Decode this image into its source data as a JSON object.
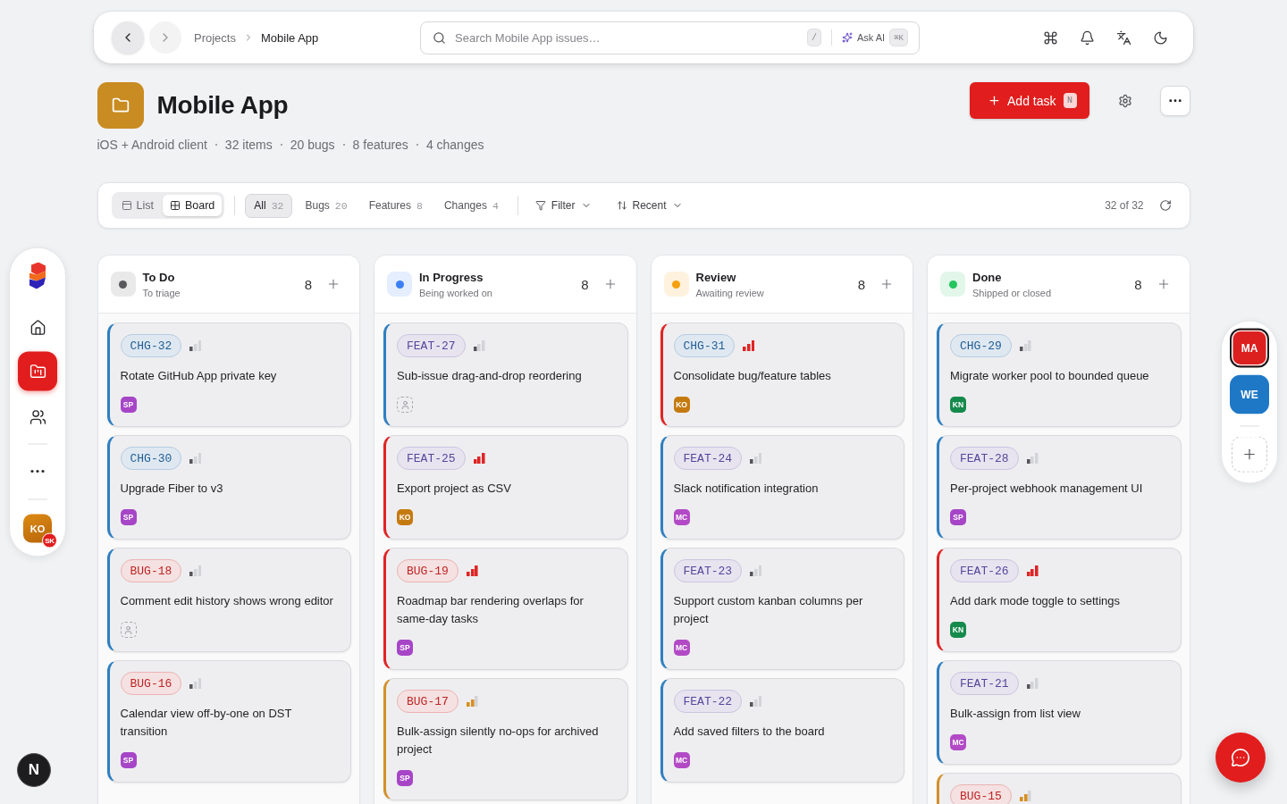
{
  "top_bar": {
    "breadcrumb": [
      "Projects",
      "Mobile App"
    ],
    "search": {
      "placeholder": "Search Mobile App issues…",
      "shortcut": "/",
      "ask_ai": {
        "label": "Ask AI",
        "shortcut": "⌘K"
      }
    }
  },
  "sidebar": {
    "items": [
      {
        "kind": "home",
        "selected": false
      },
      {
        "kind": "board",
        "selected": true
      },
      {
        "kind": "people",
        "selected": false
      }
    ],
    "user": {
      "initials": "KO",
      "badge": "SK"
    }
  },
  "project": {
    "title": "Mobile App",
    "meta": [
      "iOS + Android client",
      "32 items",
      "20 bugs",
      "8 features",
      "4 changes"
    ],
    "add_button": {
      "label": "Add task",
      "shortcut": "N"
    }
  },
  "toolbar": {
    "views": [
      {
        "kind": "list",
        "label": "List",
        "selected": false
      },
      {
        "kind": "board",
        "label": "Board",
        "selected": true
      }
    ],
    "filters": [
      {
        "label": "All",
        "count": "32",
        "selected": true
      },
      {
        "label": "Bugs",
        "count": "20",
        "selected": false
      },
      {
        "label": "Features",
        "count": "8",
        "selected": false
      },
      {
        "label": "Changes",
        "count": "4",
        "selected": false
      }
    ],
    "filter_button": "Filter",
    "sort_button": "Recent",
    "result_count": "32 of 32"
  },
  "columns": [
    {
      "title": "To Do",
      "subtitle": "To triage",
      "count": "8",
      "color": "#59595e",
      "cards": [
        {
          "id": "CHG-32",
          "kind": "change",
          "level": 0.33,
          "title": "Rotate GitHub App private key",
          "assignee": {
            "initials": "SP",
            "color": "#a646c7"
          }
        },
        {
          "id": "CHG-30",
          "kind": "change",
          "level": 0.33,
          "title": "Upgrade Fiber to v3",
          "assignee": {
            "initials": "SP",
            "color": "#a646c7"
          }
        },
        {
          "id": "BUG-18",
          "kind": "bug",
          "level": 0.33,
          "title": "Comment edit history shows wrong editor"
        },
        {
          "id": "BUG-16",
          "kind": "bug",
          "level": 0.33,
          "title": "Calendar view off-by-one on DST transition",
          "assignee": {
            "initials": "SP",
            "color": "#a646c7"
          }
        }
      ]
    },
    {
      "title": "In Progress",
      "subtitle": "Being worked on",
      "count": "8",
      "color": "#3b7ff5",
      "cards": [
        {
          "id": "FEAT-27",
          "kind": "feature",
          "level": 0.33,
          "title": "Sub-issue drag-and-drop reordering"
        },
        {
          "id": "FEAT-25",
          "kind": "feature",
          "level": 1,
          "title": "Export project as CSV",
          "assignee": {
            "initials": "KO",
            "color": "#c57a10"
          }
        },
        {
          "id": "BUG-19",
          "kind": "bug",
          "level": 1,
          "title": "Roadmap bar rendering overlaps for same-day tasks",
          "assignee": {
            "initials": "SP",
            "color": "#a646c7"
          }
        },
        {
          "id": "BUG-17",
          "kind": "bug",
          "level": 0.67,
          "title": "Bulk-assign silently no-ops for archived project",
          "assignee": {
            "initials": "SP",
            "color": "#a646c7"
          }
        }
      ]
    },
    {
      "title": "Review",
      "subtitle": "Awaiting review",
      "count": "8",
      "color": "#f5a00b",
      "cards": [
        {
          "id": "CHG-31",
          "kind": "change",
          "level": 1,
          "title": "Consolidate bug/feature tables",
          "assignee": {
            "initials": "KO",
            "color": "#c57a10"
          }
        },
        {
          "id": "FEAT-24",
          "kind": "feature",
          "level": 0.33,
          "title": "Slack notification integration",
          "assignee": {
            "initials": "MC",
            "color": "#b24ac6"
          }
        },
        {
          "id": "FEAT-23",
          "kind": "feature",
          "level": 0.33,
          "title": "Support custom kanban columns per project",
          "assignee": {
            "initials": "MC",
            "color": "#b24ac6"
          }
        },
        {
          "id": "FEAT-22",
          "kind": "feature",
          "level": 0.33,
          "title": "Add saved filters to the board",
          "assignee": {
            "initials": "MC",
            "color": "#b24ac6"
          }
        }
      ]
    },
    {
      "title": "Done",
      "subtitle": "Shipped or closed",
      "count": "8",
      "color": "#22c55e",
      "cards": [
        {
          "id": "CHG-29",
          "kind": "change",
          "level": 0.33,
          "title": "Migrate worker pool to bounded queue",
          "assignee": {
            "initials": "KN",
            "color": "#168a4c"
          }
        },
        {
          "id": "FEAT-28",
          "kind": "feature",
          "level": 0.33,
          "title": "Per-project webhook management UI",
          "assignee": {
            "initials": "SP",
            "color": "#a646c7"
          }
        },
        {
          "id": "FEAT-26",
          "kind": "feature",
          "level": 1,
          "title": "Add dark mode toggle to settings",
          "assignee": {
            "initials": "KN",
            "color": "#168a4c"
          }
        },
        {
          "id": "FEAT-21",
          "kind": "feature",
          "level": 0.33,
          "title": "Bulk-assign from list view",
          "assignee": {
            "initials": "MC",
            "color": "#b24ac6"
          }
        },
        {
          "id": "BUG-15",
          "kind": "bug",
          "level": 0.67
        }
      ]
    }
  ],
  "workspaces": [
    {
      "initials": "MA",
      "color": "#dc1f1f",
      "selected": true
    },
    {
      "initials": "WE",
      "color": "#1f78c6",
      "selected": false
    }
  ],
  "dev_badge": "N"
}
